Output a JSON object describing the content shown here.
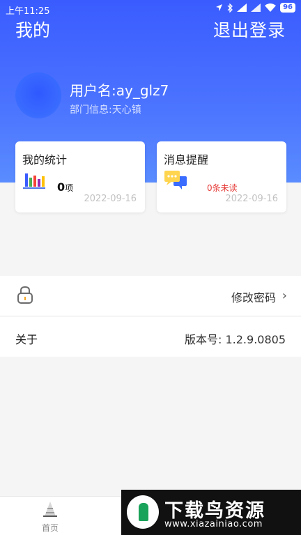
{
  "status_bar": {
    "time": "上午11:25",
    "battery": "96",
    "icons": [
      "location-icon",
      "bluetooth-icon",
      "signal-icon",
      "signal-icon",
      "wifi-icon",
      "battery-icon"
    ]
  },
  "header": {
    "title": "我的",
    "logout_label": "退出登录"
  },
  "profile": {
    "username": "用户名:ay_glz7",
    "department": "部门信息:天心镇"
  },
  "cards": {
    "stats": {
      "title": "我的统计",
      "count": "0",
      "unit": "项",
      "date": "2022-09-16",
      "icon": "bar-chart-icon"
    },
    "messages": {
      "title": "消息提醒",
      "unread": "0条未读",
      "date": "2022-09-16",
      "icon": "chat-bubble-icon"
    }
  },
  "settings": {
    "change_password_label": "修改密码",
    "about_label": "关于",
    "version_label": "版本号: 1.2.9.0805"
  },
  "bottom_nav": {
    "home_label": "首页"
  },
  "watermark": {
    "title": "下载鸟资源",
    "url": "www.xiazainiao.com"
  },
  "colors": {
    "header_blue": "#3a5cff",
    "unread_red": "#e53935",
    "date_gray": "#c2c2c2"
  }
}
